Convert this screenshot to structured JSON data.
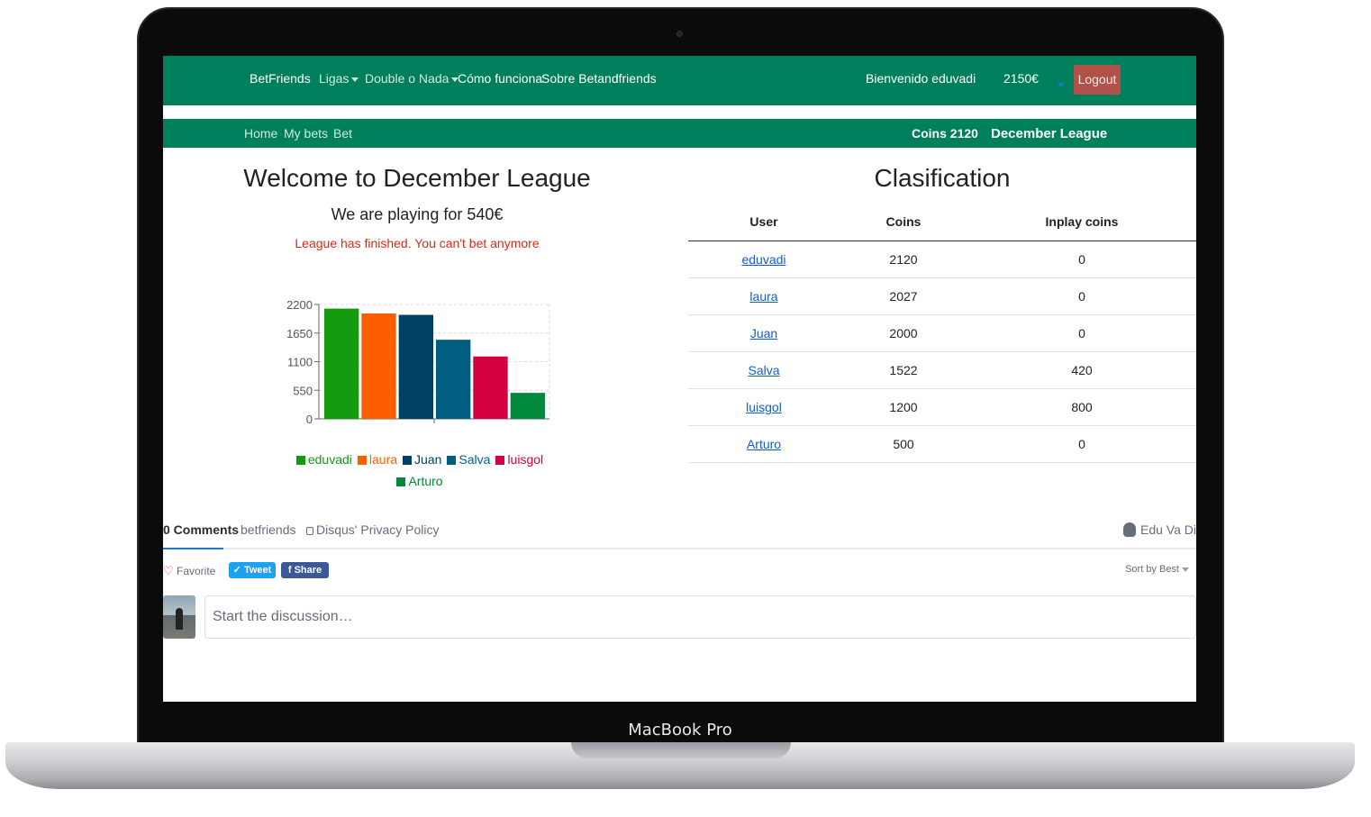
{
  "device_label": "MacBook Pro",
  "topnav": {
    "brand": "BetFriends",
    "ligas": "Ligas",
    "double": "Double o Nada",
    "como": "Cómo funciona",
    "sobre": "Sobre Betandfriends",
    "welcome": "Bienvenido eduvadi",
    "balance": "2150€",
    "logout": "Logout"
  },
  "subnav": {
    "home": "Home",
    "mybets": "My bets",
    "bet": "Bet",
    "coins": "Coins 2120",
    "league": "December League"
  },
  "main": {
    "title": "Welcome to December League",
    "playing": "We are playing for 540€",
    "finished": "League has finished. You can't bet anymore"
  },
  "chart_data": {
    "type": "bar",
    "categories": [
      "eduvadi",
      "laura",
      "Juan",
      "Salva",
      "luisgol",
      "Arturo"
    ],
    "values": [
      2120,
      2027,
      2000,
      1522,
      1200,
      500
    ],
    "colors": [
      "#139b0e",
      "#ff5e00",
      "#004064",
      "#005e80",
      "#d5003f",
      "#00893a"
    ],
    "ylim": [
      0,
      2200
    ],
    "yticks": [
      "2200",
      "1650",
      "1100",
      "550",
      "0"
    ],
    "grid": true,
    "legend_position": "bottom"
  },
  "clasification": {
    "title": "Clasification",
    "headers": [
      "User",
      "Coins",
      "Inplay coins"
    ],
    "rows": [
      {
        "user": "eduvadi",
        "coins": "2120",
        "inplay": "0"
      },
      {
        "user": "laura",
        "coins": "2027",
        "inplay": "0"
      },
      {
        "user": "Juan",
        "coins": "2000",
        "inplay": "0"
      },
      {
        "user": "Salva",
        "coins": "1522",
        "inplay": "420"
      },
      {
        "user": "luisgol",
        "coins": "1200",
        "inplay": "800"
      },
      {
        "user": "Arturo",
        "coins": "500",
        "inplay": "0"
      }
    ]
  },
  "disqus": {
    "comments": "0 Comments",
    "forum": "betfriends",
    "privacy": "Disqus' Privacy Policy",
    "user": "Edu Va Di",
    "favorite": "Favorite",
    "tweet": "Tweet",
    "share": "Share",
    "sort": "Sort by Best",
    "placeholder": "Start the discussion…"
  }
}
